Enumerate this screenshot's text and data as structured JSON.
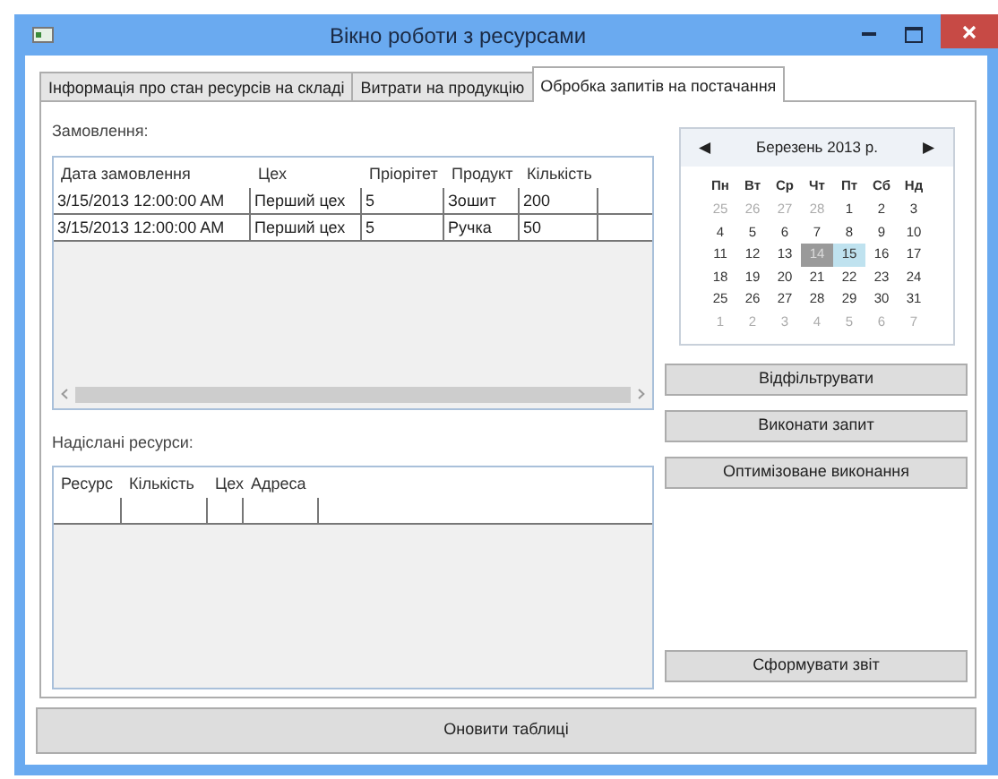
{
  "window": {
    "title": "Вікно роботи з ресурсами"
  },
  "tabs": [
    {
      "label": "Інформація про стан ресурсів на складі",
      "selected": false
    },
    {
      "label": "Витрати на продукцію",
      "selected": false
    },
    {
      "label": "Обробка запитів на постачання",
      "selected": true
    }
  ],
  "orders": {
    "label": "Замовлення:",
    "columns": [
      "Дата замовлення",
      "Цех",
      "Пріорітет",
      "Продукт",
      "Кількість"
    ],
    "rows": [
      [
        "3/15/2013 12:00:00 AM",
        "Перший цех",
        "5",
        "Зошит",
        "200"
      ],
      [
        "3/15/2013 12:00:00 AM",
        "Перший цех",
        "5",
        "Ручка",
        "50"
      ]
    ]
  },
  "sent_resources": {
    "label": "Надіслані ресурси:",
    "columns": [
      "Ресурс",
      "Кількість",
      "Цех",
      "Адреса"
    ]
  },
  "calendar": {
    "prev": "◀",
    "month": "Березень 2013 р.",
    "next": "▶",
    "weekdays": [
      "Пн",
      "Вт",
      "Ср",
      "Чт",
      "Пт",
      "Сб",
      "Нд"
    ],
    "days": [
      {
        "label": "25",
        "other_month": true,
        "selected": false,
        "today": false
      },
      {
        "label": "26",
        "other_month": true,
        "selected": false,
        "today": false
      },
      {
        "label": "27",
        "other_month": true,
        "selected": false,
        "today": false
      },
      {
        "label": "28",
        "other_month": true,
        "selected": false,
        "today": false
      },
      {
        "label": "1",
        "other_month": false,
        "selected": false,
        "today": false
      },
      {
        "label": "2",
        "other_month": false,
        "selected": false,
        "today": false
      },
      {
        "label": "3",
        "other_month": false,
        "selected": false,
        "today": false
      },
      {
        "label": "4",
        "other_month": false,
        "selected": false,
        "today": false
      },
      {
        "label": "5",
        "other_month": false,
        "selected": false,
        "today": false
      },
      {
        "label": "6",
        "other_month": false,
        "selected": false,
        "today": false
      },
      {
        "label": "7",
        "other_month": false,
        "selected": false,
        "today": false
      },
      {
        "label": "8",
        "other_month": false,
        "selected": false,
        "today": false
      },
      {
        "label": "9",
        "other_month": false,
        "selected": false,
        "today": false
      },
      {
        "label": "10",
        "other_month": false,
        "selected": false,
        "today": false
      },
      {
        "label": "11",
        "other_month": false,
        "selected": false,
        "today": false
      },
      {
        "label": "12",
        "other_month": false,
        "selected": false,
        "today": false
      },
      {
        "label": "13",
        "other_month": false,
        "selected": false,
        "today": false
      },
      {
        "label": "14",
        "other_month": false,
        "selected": true,
        "today": false
      },
      {
        "label": "15",
        "other_month": false,
        "selected": false,
        "today": true
      },
      {
        "label": "16",
        "other_month": false,
        "selected": false,
        "today": false
      },
      {
        "label": "17",
        "other_month": false,
        "selected": false,
        "today": false
      },
      {
        "label": "18",
        "other_month": false,
        "selected": false,
        "today": false
      },
      {
        "label": "19",
        "other_month": false,
        "selected": false,
        "today": false
      },
      {
        "label": "20",
        "other_month": false,
        "selected": false,
        "today": false
      },
      {
        "label": "21",
        "other_month": false,
        "selected": false,
        "today": false
      },
      {
        "label": "22",
        "other_month": false,
        "selected": false,
        "today": false
      },
      {
        "label": "23",
        "other_month": false,
        "selected": false,
        "today": false
      },
      {
        "label": "24",
        "other_month": false,
        "selected": false,
        "today": false
      },
      {
        "label": "25",
        "other_month": false,
        "selected": false,
        "today": false
      },
      {
        "label": "26",
        "other_month": false,
        "selected": false,
        "today": false
      },
      {
        "label": "27",
        "other_month": false,
        "selected": false,
        "today": false
      },
      {
        "label": "28",
        "other_month": false,
        "selected": false,
        "today": false
      },
      {
        "label": "29",
        "other_month": false,
        "selected": false,
        "today": false
      },
      {
        "label": "30",
        "other_month": false,
        "selected": false,
        "today": false
      },
      {
        "label": "31",
        "other_month": false,
        "selected": false,
        "today": false
      },
      {
        "label": "1",
        "other_month": true,
        "selected": false,
        "today": false
      },
      {
        "label": "2",
        "other_month": true,
        "selected": false,
        "today": false
      },
      {
        "label": "3",
        "other_month": true,
        "selected": false,
        "today": false
      },
      {
        "label": "4",
        "other_month": true,
        "selected": false,
        "today": false
      },
      {
        "label": "5",
        "other_month": true,
        "selected": false,
        "today": false
      },
      {
        "label": "6",
        "other_month": true,
        "selected": false,
        "today": false
      },
      {
        "label": "7",
        "other_month": true,
        "selected": false,
        "today": false
      }
    ]
  },
  "action_buttons": [
    "Відфільтрувати",
    "Виконати запит",
    "Оптимізоване виконання"
  ],
  "report_button": "Сформувати звіт",
  "refresh_button": "Оновити таблиці"
}
